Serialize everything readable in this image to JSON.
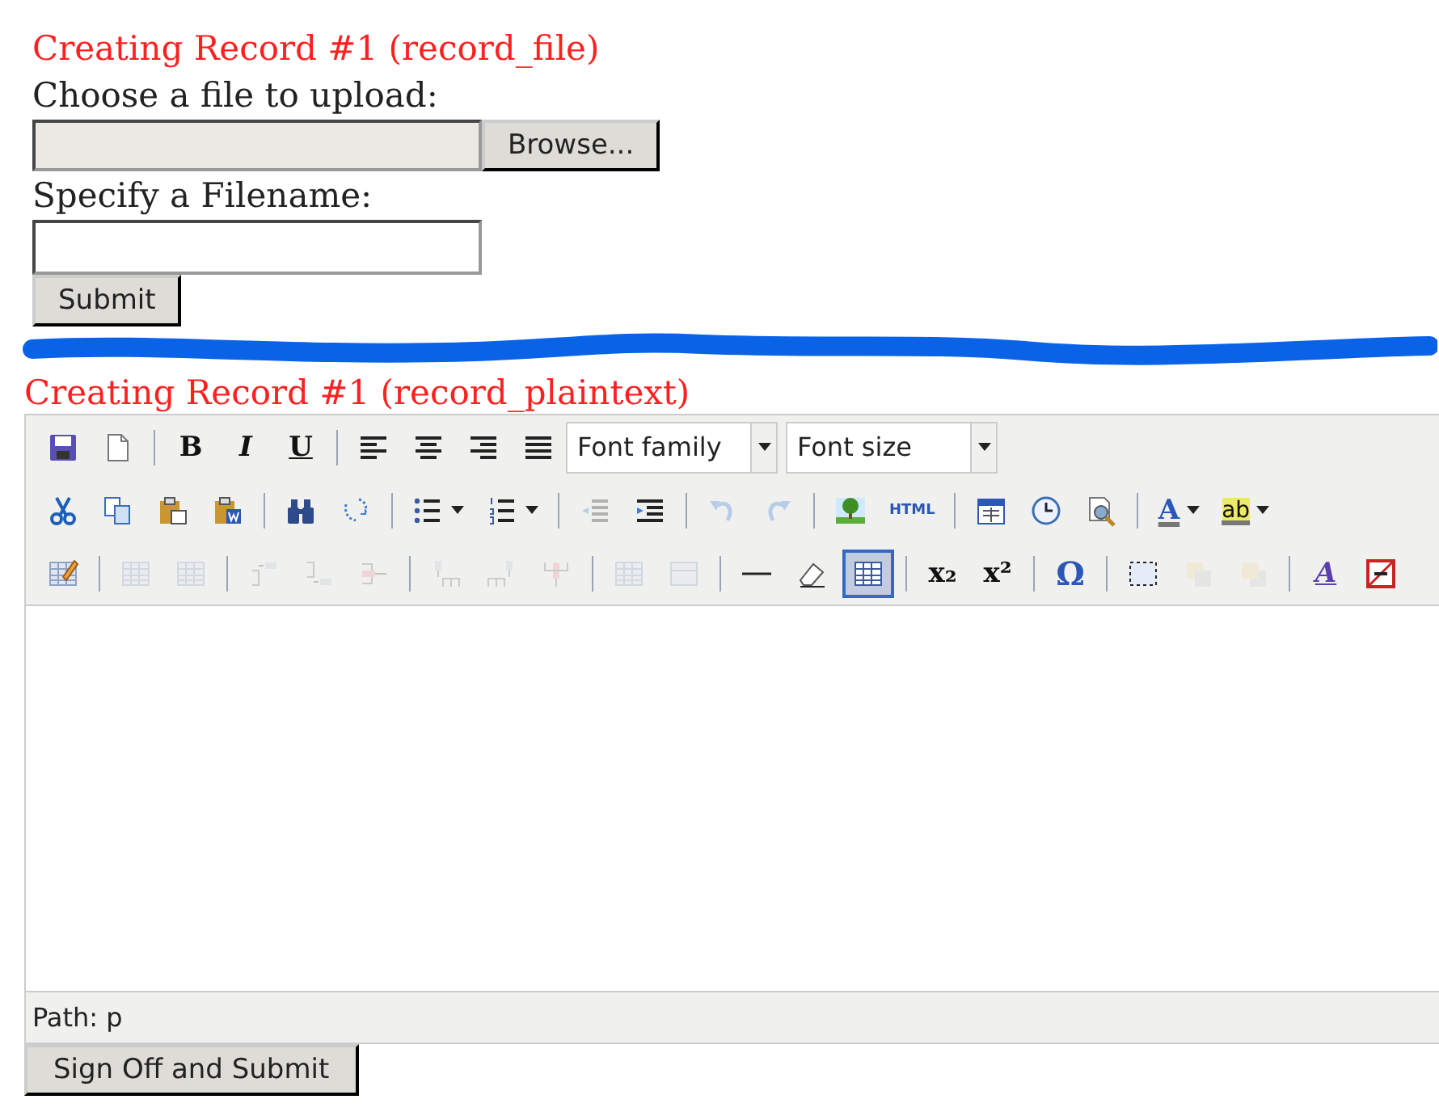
{
  "form": {
    "title": "Creating Record #1 (record_file)",
    "file_label": "Choose a file to upload:",
    "browse_button": "Browse...",
    "filename_label": "Specify a Filename:",
    "submit_button": "Submit"
  },
  "editor": {
    "title": "Creating Record #1 (record_plaintext)",
    "toolbar_rows": [
      [
        {
          "kind": "save",
          "disabled": false,
          "selected": false
        },
        {
          "kind": "newdoc",
          "disabled": false,
          "selected": false
        },
        {
          "kind": "separator"
        },
        {
          "kind": "bold",
          "label": "B",
          "disabled": false,
          "selected": false
        },
        {
          "kind": "italic",
          "label": "I",
          "disabled": false,
          "selected": false
        },
        {
          "kind": "underline",
          "label": "U",
          "disabled": false,
          "selected": false
        },
        {
          "kind": "separator"
        },
        {
          "kind": "alignleft",
          "disabled": false,
          "selected": false
        },
        {
          "kind": "aligncenter",
          "disabled": false,
          "selected": false
        },
        {
          "kind": "alignright",
          "disabled": false,
          "selected": false
        },
        {
          "kind": "justify",
          "disabled": false,
          "selected": false
        },
        {
          "kind": "select",
          "label": "Font family"
        },
        {
          "kind": "select",
          "label": "Font size"
        }
      ],
      [
        {
          "kind": "cut",
          "disabled": false,
          "selected": false
        },
        {
          "kind": "copy",
          "disabled": false,
          "selected": false
        },
        {
          "kind": "paste",
          "disabled": false,
          "selected": false
        },
        {
          "kind": "pasteword",
          "disabled": false,
          "selected": false
        },
        {
          "kind": "separator"
        },
        {
          "kind": "find",
          "disabled": false,
          "selected": false
        },
        {
          "kind": "replace",
          "disabled": false,
          "selected": false
        },
        {
          "kind": "separator"
        },
        {
          "kind": "bullist",
          "disabled": false,
          "selected": false
        },
        {
          "kind": "numlist",
          "disabled": false,
          "selected": false
        },
        {
          "kind": "separator"
        },
        {
          "kind": "outdent",
          "disabled": true,
          "selected": false
        },
        {
          "kind": "indent",
          "disabled": false,
          "selected": false
        },
        {
          "kind": "separator"
        },
        {
          "kind": "undo",
          "disabled": true,
          "selected": false
        },
        {
          "kind": "redo",
          "disabled": true,
          "selected": false
        },
        {
          "kind": "separator"
        },
        {
          "kind": "image",
          "disabled": false,
          "selected": false
        },
        {
          "kind": "html",
          "label": "HTML",
          "disabled": false,
          "selected": false
        },
        {
          "kind": "separator"
        },
        {
          "kind": "date",
          "disabled": false,
          "selected": false
        },
        {
          "kind": "time",
          "disabled": false,
          "selected": false
        },
        {
          "kind": "preview",
          "disabled": false,
          "selected": false
        },
        {
          "kind": "separator"
        },
        {
          "kind": "forecolor",
          "label": "A",
          "disabled": false,
          "selected": false
        },
        {
          "kind": "backcolor",
          "label": "ab",
          "disabled": false,
          "selected": false
        }
      ],
      [
        {
          "kind": "tableedit",
          "disabled": false,
          "selected": false
        },
        {
          "kind": "separator"
        },
        {
          "kind": "rowprops",
          "disabled": true,
          "selected": false
        },
        {
          "kind": "cellprops",
          "disabled": true,
          "selected": false
        },
        {
          "kind": "separator"
        },
        {
          "kind": "rowbefore",
          "disabled": true,
          "selected": false
        },
        {
          "kind": "rowafter",
          "disabled": true,
          "selected": false
        },
        {
          "kind": "deleterow",
          "disabled": true,
          "selected": false
        },
        {
          "kind": "separator"
        },
        {
          "kind": "colbefore",
          "disabled": true,
          "selected": false
        },
        {
          "kind": "colafter",
          "disabled": true,
          "selected": false
        },
        {
          "kind": "deletecol",
          "disabled": true,
          "selected": false
        },
        {
          "kind": "separator"
        },
        {
          "kind": "split",
          "disabled": true,
          "selected": false
        },
        {
          "kind": "merge",
          "disabled": true,
          "selected": false
        },
        {
          "kind": "separator"
        },
        {
          "kind": "hr",
          "disabled": false,
          "selected": false
        },
        {
          "kind": "eraser",
          "disabled": false,
          "selected": false
        },
        {
          "kind": "visualaid",
          "disabled": false,
          "selected": true
        },
        {
          "kind": "separator"
        },
        {
          "kind": "sub",
          "label": "x₂",
          "disabled": false,
          "selected": false
        },
        {
          "kind": "sup",
          "label": "x²",
          "disabled": false,
          "selected": false
        },
        {
          "kind": "separator"
        },
        {
          "kind": "charmap",
          "label": "Ω",
          "disabled": false,
          "selected": false
        },
        {
          "kind": "separator"
        },
        {
          "kind": "absolute",
          "disabled": false,
          "selected": false
        },
        {
          "kind": "forward",
          "disabled": true,
          "selected": false
        },
        {
          "kind": "backward",
          "disabled": true,
          "selected": false
        },
        {
          "kind": "separator"
        },
        {
          "kind": "styleprops",
          "label": "A",
          "disabled": false,
          "selected": false
        },
        {
          "kind": "nonbreaking",
          "disabled": false,
          "selected": false
        }
      ]
    ],
    "path": "Path: p"
  },
  "sign_off_button": "Sign Off and Submit"
}
